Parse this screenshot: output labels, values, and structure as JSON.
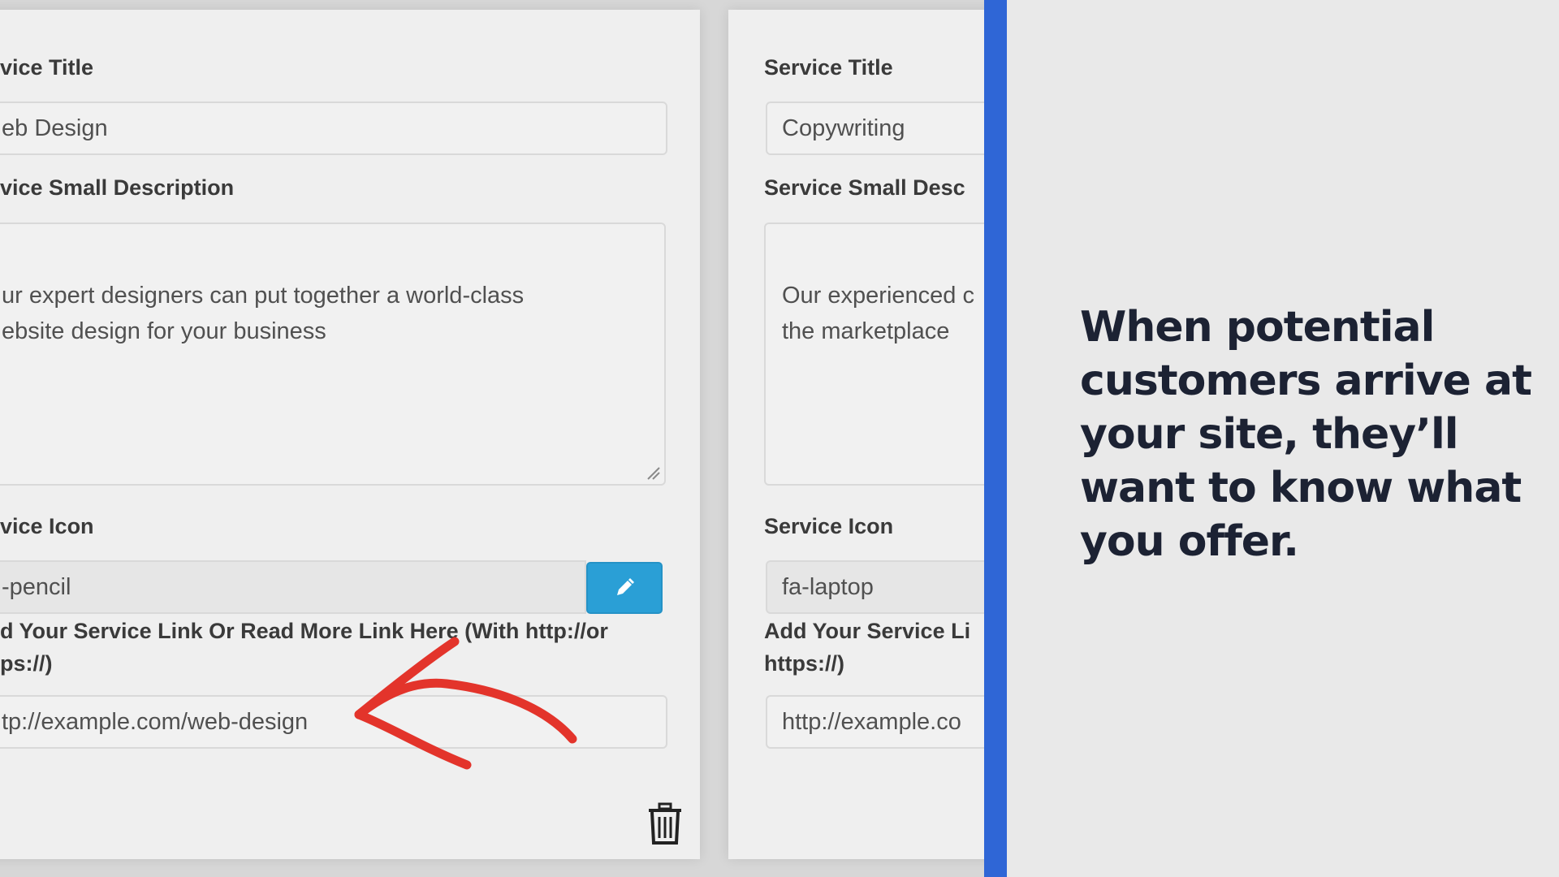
{
  "left_card": {
    "title_label": "vice Title",
    "title_value": "eb Design",
    "desc_label": "vice Small Description",
    "desc_value": "ur expert designers can put together a world-class\nebsite design for your business",
    "icon_label": "vice Icon",
    "icon_value": "-pencil",
    "link_label": "d Your Service Link Or Read More Link Here (With http://or\nps://)",
    "link_value": "tp://example.com/web-design"
  },
  "right_card": {
    "title_label": "Service Title",
    "title_value": "Copywriting",
    "desc_label": "Service Small Desc",
    "desc_value": "Our experienced c\nthe marketplace",
    "icon_label": "Service Icon",
    "icon_value": "fa-laptop",
    "link_label": "Add Your Service Li\nhttps://)",
    "link_value": "http://example.co"
  },
  "icons": {
    "pencil": "pencil-icon",
    "trash": "trash-icon",
    "arrow": "red-arrow-annotation"
  },
  "colors": {
    "accent_blue": "#2f66d6",
    "pencil_button": "#2a9fd6",
    "arrow_red": "#e3342b",
    "caption_text": "#1c2233"
  },
  "caption": "When potential customers arrive at your site, they’ll want to know what you offer."
}
